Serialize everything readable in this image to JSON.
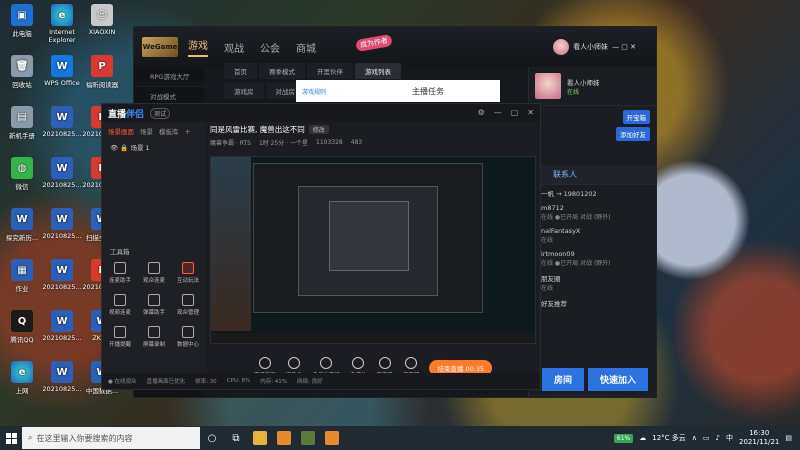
{
  "desktop_icons": [
    {
      "label": "此电脑",
      "glyph": "▣",
      "color": "g-blue"
    },
    {
      "label": "Internet Explorer",
      "glyph": "e",
      "color": "g-edge"
    },
    {
      "label": "XIAOXIN",
      "glyph": "☺",
      "color": "g-user"
    },
    {
      "label": "回收站",
      "glyph": "🗑",
      "color": "g-grey"
    },
    {
      "label": "WPS Office",
      "glyph": "W",
      "color": "g-wps"
    },
    {
      "label": "福昕阅读器",
      "glyph": "P",
      "color": "g-pdf"
    },
    {
      "label": "新机手册",
      "glyph": "▤",
      "color": "g-grey"
    },
    {
      "label": "20210825...",
      "glyph": "W",
      "color": "g-word"
    },
    {
      "label": "20210825...",
      "glyph": "P",
      "color": "g-pdf"
    },
    {
      "label": "微信",
      "glyph": "◍",
      "color": "g-green"
    },
    {
      "label": "20210825...",
      "glyph": "W",
      "color": "g-word"
    },
    {
      "label": "20210825...",
      "glyph": "P",
      "color": "g-pdf"
    },
    {
      "label": "探究新历...",
      "glyph": "W",
      "color": "g-word"
    },
    {
      "label": "20210825...",
      "glyph": "W",
      "color": "g-word"
    },
    {
      "label": "扫描全能王",
      "glyph": "W",
      "color": "g-word"
    },
    {
      "label": "作业",
      "glyph": "▦",
      "color": "g-word"
    },
    {
      "label": "20210825...",
      "glyph": "W",
      "color": "g-word"
    },
    {
      "label": "20210825...",
      "glyph": "P",
      "color": "g-pdf"
    },
    {
      "label": "腾讯QQ",
      "glyph": "Q",
      "color": "g-q"
    },
    {
      "label": "20210825...",
      "glyph": "W",
      "color": "g-word"
    },
    {
      "label": "ZKZ...",
      "glyph": "W",
      "color": "g-word"
    },
    {
      "label": "上网",
      "glyph": "e",
      "color": "g-edge"
    },
    {
      "label": "20210825...",
      "glyph": "W",
      "color": "g-word"
    },
    {
      "label": "中国数据...",
      "glyph": "W",
      "color": "g-word"
    }
  ],
  "launcher": {
    "logo": "WeGame",
    "tabs": [
      "游戏",
      "观战",
      "公会",
      "商城"
    ],
    "badge": "成为作者",
    "user": "看人小师妹",
    "sidebar": [
      "RPG游戏大厅",
      "对战模式"
    ],
    "subtabs": [
      "首页",
      "赛季模式",
      "开黑伙伴",
      "游戏列表"
    ],
    "subtabs2": [
      "游戏房",
      "对战房"
    ],
    "task_tab_left": "游戏规则",
    "task_tab_title": "主播任务",
    "profile_name": "看人小师妹",
    "profile_status": "在线",
    "profile_btn1": "开宝箱",
    "profile_btn2": "添加好友",
    "contacts_title": "联系人",
    "contacts": [
      {
        "name": "一帆 → 19801202",
        "sub": ""
      },
      {
        "name": "m8712",
        "sub": "在线 ●已开局 对战 (野外)"
      },
      {
        "name": "nalFantasyX",
        "sub": "在线"
      },
      {
        "name": "irtmoon09",
        "sub": "在线 ●已开局 对战 (野外)"
      },
      {
        "name": "朋友圈",
        "sub": "在线"
      },
      {
        "name": "好友推荐",
        "sub": ""
      }
    ],
    "join_buttons": [
      "房间",
      "快速加入"
    ]
  },
  "streamer": {
    "logo_prefix": "直播",
    "logo_suffix": "伴侣",
    "beta": "测试",
    "left_tabs": [
      "场景画面",
      "场景",
      "模板库"
    ],
    "scene": "场景 1",
    "tools_title": "工具箱",
    "tools": [
      "连麦助手",
      "观众连麦",
      "互动玩法",
      "视频连麦",
      "弹幕助手",
      "观众管理",
      "开播提醒",
      "屏幕录制",
      "数据中心"
    ],
    "stream_title": "同是风雷比赛, 魔兽出这不同",
    "stream_tag": "修改",
    "meta": [
      "魔兽争霸 · RTS",
      "1时 25分 · 一个星",
      "1103328",
      "483"
    ],
    "bottom_tools": [
      "直播画面",
      "摄像头",
      "多机位直播",
      "多媒体",
      "麦克风",
      "扬声器"
    ],
    "go_live": "结束直播 00:35",
    "status": [
      "● 在线观众",
      "直播画面已优化",
      "帧率: 30",
      "CPU: 8%",
      "内存: 41%",
      "网络: 良好"
    ]
  },
  "taskbar": {
    "search_placeholder": "在这里输入你要搜索的内容",
    "weather": "12°C 多云",
    "battery_pct": "61%",
    "time": "16:30",
    "date": "2021/11/21",
    "lang": "中"
  }
}
